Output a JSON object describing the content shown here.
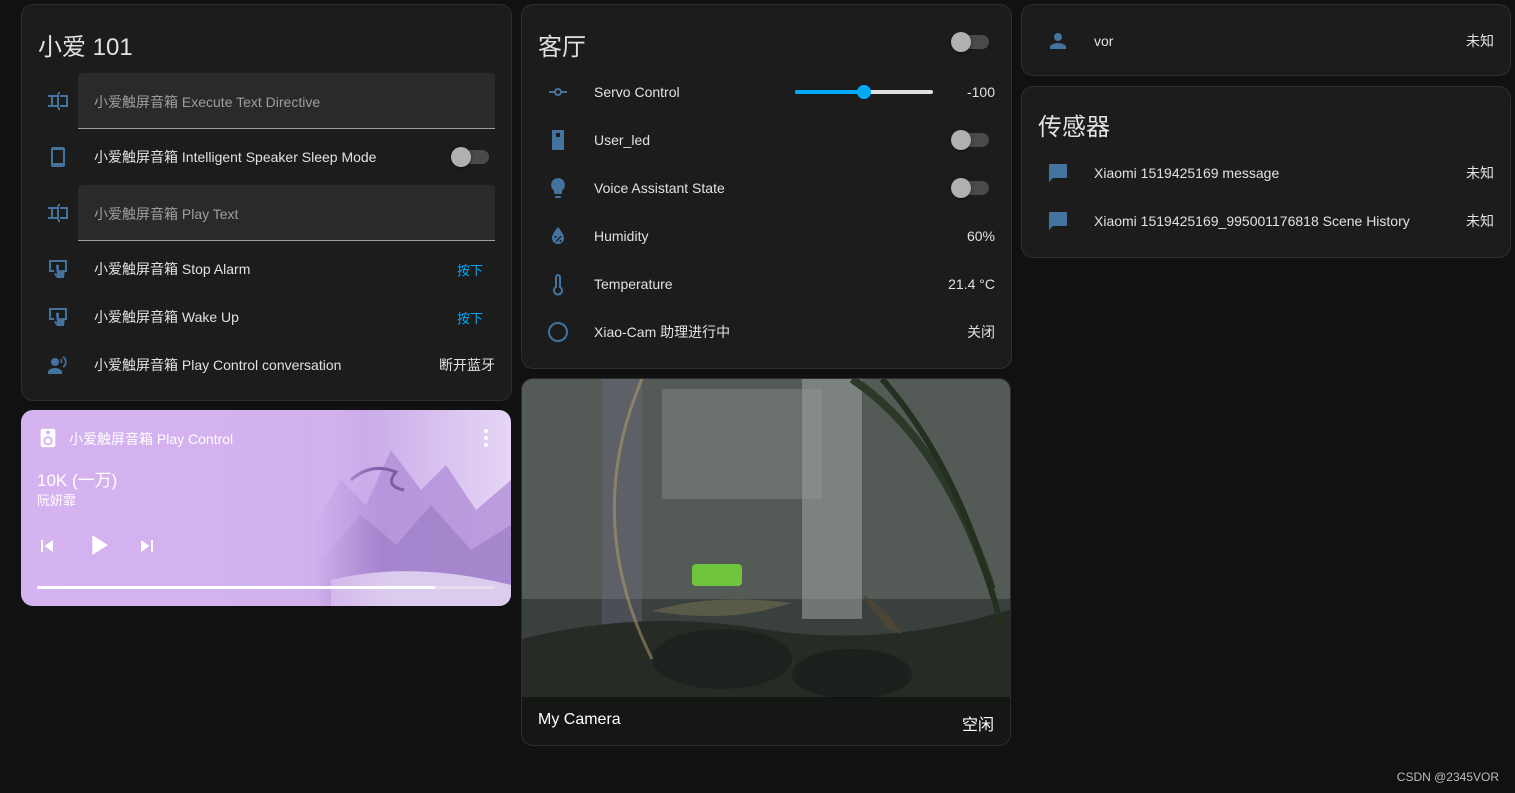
{
  "xiaoai_card": {
    "title": "小爱 101",
    "rows": [
      {
        "label": "小爱触屏音箱 Execute Text Directive",
        "icon": "text-field-icon"
      },
      {
        "label": "小爱触屏音箱 Intelligent Speaker Sleep Mode",
        "icon": "phone-icon"
      },
      {
        "label": "小爱触屏音箱 Play Text",
        "icon": "text-field-icon"
      },
      {
        "label": "小爱触屏音箱 Stop Alarm",
        "action": "按下",
        "icon": "gesture-tap-icon"
      },
      {
        "label": "小爱触屏音箱 Wake Up",
        "action": "按下",
        "icon": "gesture-tap-icon"
      },
      {
        "label": "小爱触屏音箱 Play Control conversation",
        "value": "断开蓝牙",
        "icon": "voice-person-icon"
      }
    ]
  },
  "media": {
    "title": "小爱触屏音箱 Play Control",
    "song": "10K (一万)",
    "artist": "阮妍霏",
    "progress": 0.87
  },
  "living_room": {
    "title": "客厅",
    "rows": [
      {
        "label": "Servo Control",
        "value": "-100",
        "slider": 0.5,
        "icon": "slider-icon"
      },
      {
        "label": "User_led",
        "icon": "remote-icon"
      },
      {
        "label": "Voice Assistant State",
        "icon": "lightbulb-icon"
      },
      {
        "label": "Humidity",
        "value": "60%",
        "icon": "water-percent-icon"
      },
      {
        "label": "Temperature",
        "value": "21.4 °C",
        "icon": "thermometer-icon"
      },
      {
        "label": "Xiao-Cam 助理进行中",
        "value": "关闭",
        "icon": "circle-outline-icon"
      }
    ]
  },
  "camera": {
    "name": "My Camera",
    "state": "空闲"
  },
  "person_card": {
    "name": "vor",
    "state": "未知"
  },
  "sensor_card": {
    "title": "传感器",
    "rows": [
      {
        "label": "Xiaomi 1519425169 message",
        "value": "未知"
      },
      {
        "label": "Xiaomi 1519425169_995001176818 Scene History",
        "value": "未知"
      }
    ]
  },
  "watermark": "CSDN @2345VOR",
  "colors": {
    "background": "#111111",
    "card": "#1c1c1c",
    "icon": "#44739e",
    "accent": "#03a9f4",
    "media_bg": "#d5b3f0"
  }
}
